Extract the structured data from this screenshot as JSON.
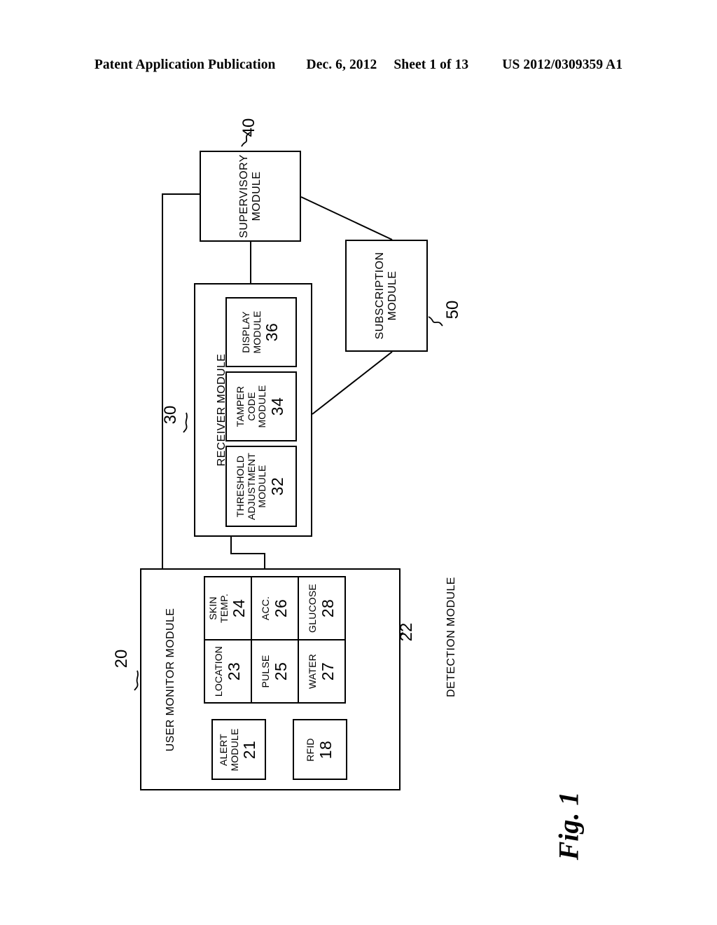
{
  "header": {
    "publication": "Patent Application Publication",
    "date": "Dec. 6, 2012",
    "sheet": "Sheet 1 of 13",
    "docnumber": "US 2012/0309359 A1"
  },
  "figure": {
    "caption": "Fig. 1"
  },
  "blocks": {
    "supervisory": {
      "label_line1": "SUPERVISORY",
      "label_line2": "MODULE",
      "ref": "40"
    },
    "subscription": {
      "label_line1": "SUBSCRIPTION",
      "label_line2": "MODULE",
      "ref": "50"
    },
    "receiver": {
      "label": "RECEIVER MODULE",
      "ref": "30"
    },
    "user_monitor": {
      "label": "USER MONITOR MODULE",
      "ref": "20"
    },
    "detection": {
      "label": "DETECTION MODULE",
      "ref": "22"
    }
  },
  "receiver_submodules": [
    {
      "name": "threshold-adjustment-module",
      "label_line1": "THRESHOLD",
      "label_line2": "ADJUSTMENT",
      "label_line3": "MODULE",
      "ref": "32"
    },
    {
      "name": "tamper-code-module",
      "label_line1": "TAMPER",
      "label_line2": "CODE",
      "label_line3": "MODULE",
      "ref": "34"
    },
    {
      "name": "display-module",
      "label_line1": "DISPLAY",
      "label_line2": "MODULE",
      "label_line3": "",
      "ref": "36"
    }
  ],
  "monitor_submodules": [
    {
      "name": "alert-module",
      "label_line1": "ALERT",
      "label_line2": "MODULE",
      "ref": "21"
    },
    {
      "name": "rfid-module",
      "label_line1": "RFID",
      "label_line2": "",
      "ref": "18"
    }
  ],
  "detection_sensors": [
    {
      "name": "location-sensor",
      "label_line1": "LOCATION",
      "label_line2": "",
      "ref": "23"
    },
    {
      "name": "skin-temp-sensor",
      "label_line1": "SKIN",
      "label_line2": "TEMP.",
      "ref": "24"
    },
    {
      "name": "pulse-sensor",
      "label_line1": "PULSE",
      "label_line2": "",
      "ref": "25"
    },
    {
      "name": "acc-sensor",
      "label_line1": "ACC.",
      "label_line2": "",
      "ref": "26"
    },
    {
      "name": "water-sensor",
      "label_line1": "WATER",
      "label_line2": "",
      "ref": "27"
    },
    {
      "name": "glucose-sensor",
      "label_line1": "GLUCOSE",
      "label_line2": "",
      "ref": "28"
    }
  ]
}
